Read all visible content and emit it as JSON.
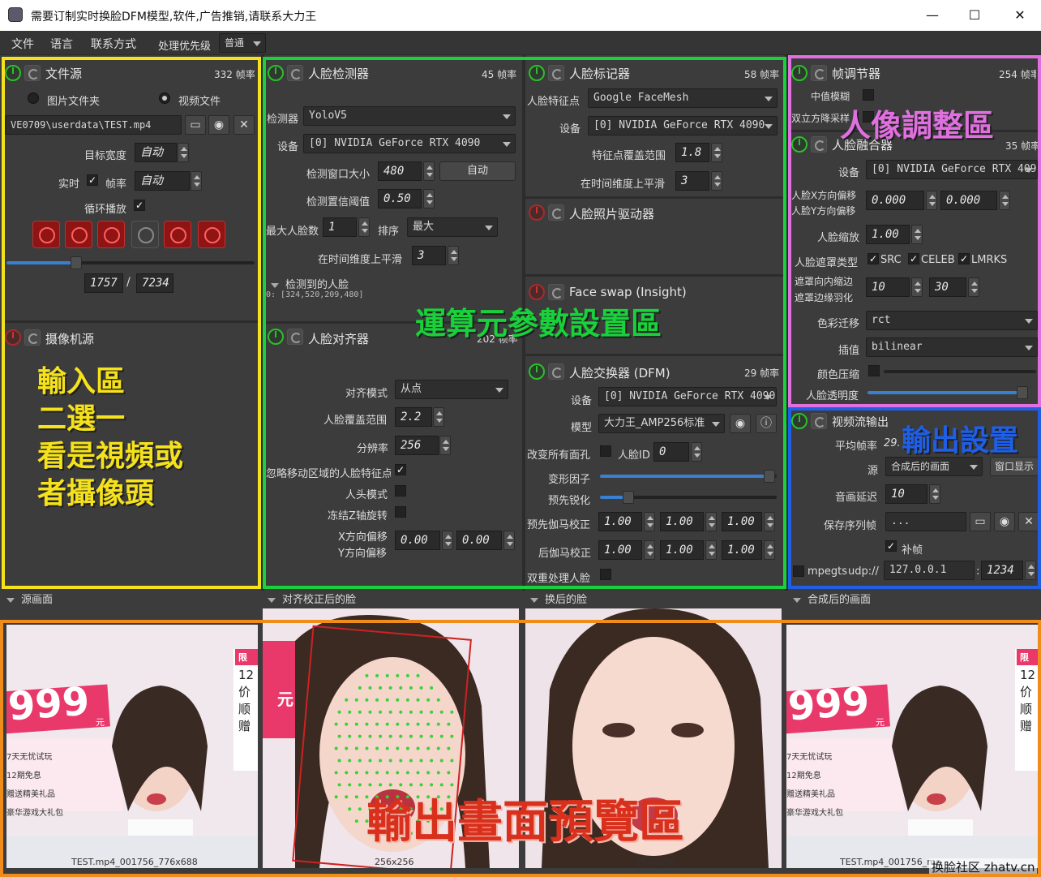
{
  "window": {
    "title": "需要订制实时换脸DFM模型,软件,广告推销,请联系大力王"
  },
  "menu": {
    "file": "文件",
    "language": "语言",
    "contact": "联系方式",
    "priority_label": "处理优先级",
    "priority_value": "普通"
  },
  "file_source": {
    "title": "文件源",
    "fps": "332 帧率",
    "image_folder": "图片文件夹",
    "video_file": "视频文件",
    "path": "VE0709\\userdata\\TEST.mp4",
    "target_width_label": "目标宽度",
    "target_width_value": "自动",
    "realtime_label": "实时",
    "fps_label": "帧率",
    "fps_value": "自动",
    "loop_label": "循环播放",
    "frame_current": "1757",
    "frame_sep": "/",
    "frame_total": "7234",
    "seek_position": 0.28
  },
  "camera_source": {
    "title": "摄像机源"
  },
  "face_detector": {
    "title": "人脸检测器",
    "fps": "45 帧率",
    "detector_label": "检测器",
    "detector_value": "YoloV5",
    "device_label": "设备",
    "device_value": "[0] NVIDIA GeForce RTX 4090",
    "window_label": "检测窗口大小",
    "window_value": "480",
    "auto_button": "自动",
    "threshold_label": "检测置信阈值",
    "threshold_value": "0.50",
    "max_faces_label": "最大人脸数",
    "max_faces_value": "1",
    "sort_label": "排序",
    "sort_value": "最大",
    "smooth_label": "在时间维度上平滑",
    "smooth_value": "3",
    "detected_label": "检测到的人脸",
    "detected_value": "0: [324,520,209,480]"
  },
  "face_aligner": {
    "title": "人脸对齐器",
    "fps": "202 帧率",
    "mode_label": "对齐模式",
    "mode_value": "从点",
    "coverage_label": "人脸覆盖范围",
    "coverage_value": "2.2",
    "resolution_label": "分辨率",
    "resolution_value": "256",
    "ignore_label": "忽略移动区域的人脸特征点",
    "head_mode_label": "人头模式",
    "freeze_z_label": "冻结Z轴旋转",
    "x_offset_label": "X方向偏移",
    "y_offset_label": "Y方向偏移",
    "x_offset_value": "0.00",
    "y_offset_value": "0.00"
  },
  "face_marker": {
    "title": "人脸标记器",
    "fps": "58 帧率",
    "landmarks_label": "人脸特征点",
    "landmarks_value": "Google FaceMesh",
    "device_label": "设备",
    "device_value": "[0] NVIDIA GeForce RTX 4090",
    "range_label": "特征点覆盖范围",
    "range_value": "1.8",
    "smooth_label": "在时间维度上平滑",
    "smooth_value": "3"
  },
  "face_animator": {
    "title": "人脸照片驱动器"
  },
  "face_swap_insight": {
    "title": "Face swap (Insight)"
  },
  "face_swapper": {
    "title": "人脸交换器 (DFM)",
    "fps": "29 帧率",
    "device_label": "设备",
    "device_value": "[0] NVIDIA GeForce RTX 4090",
    "model_label": "模型",
    "model_value": "大力王_AMP256标准",
    "swap_all_label": "改变所有面孔",
    "face_id_label": "人脸ID",
    "face_id_value": "0",
    "morph_label": "变形因子",
    "morph_position": 0.96,
    "presharpen_label": "预先锐化",
    "presharpen_position": 0.16,
    "pre_gamma_label": "预先伽马校正",
    "post_gamma_label": "后伽马校正",
    "gamma_values": [
      "1.00",
      "1.00",
      "1.00"
    ],
    "two_pass_label": "双重处理人脸"
  },
  "frame_adjuster": {
    "title": "帧调节器",
    "fps": "254 帧率",
    "median_label": "中值模糊",
    "bilinear_label": "双立方降采样"
  },
  "face_merger": {
    "title": "人脸融合器",
    "fps": "35 帧率",
    "device_label": "设备",
    "device_value": "[0] NVIDIA GeForce RTX 4090",
    "x_offset_label": "人脸X方向偏移",
    "y_offset_label": "人脸Y方向偏移",
    "x_offset_value": "0.000",
    "y_offset_value": "0.000",
    "scale_label": "人脸缩放",
    "scale_value": "1.00",
    "mask_type_label": "人脸遮罩类型",
    "mask_src": "SRC",
    "mask_celeb": "CELEB",
    "mask_lmrks": "LMRKS",
    "erode_label": "遮罩向内缩边",
    "blur_label": "遮罩边缘羽化",
    "erode_value": "10",
    "blur_value": "30",
    "color_transfer_label": "色彩迁移",
    "color_transfer_value": "rct",
    "interp_label": "插值",
    "interp_value": "bilinear",
    "color_compress_label": "颜色压缩",
    "opacity_label": "人脸透明度",
    "opacity_position": 1.0
  },
  "stream_output": {
    "title": "视频流输出",
    "avg_fps_label": "平均帧率",
    "avg_fps_value": "29.",
    "source_label": "源",
    "source_value": "合成后的画面",
    "window_button": "窗口显示",
    "delay_label": "音画延迟",
    "delay_value": "10",
    "save_label": "保存序列帧",
    "save_value": "...",
    "fill_label": "补帧",
    "mpegts_label": "mpegts",
    "udp_label": "udp://",
    "ip_value": "127.0.0.1",
    "port_sep": ":",
    "port_value": "1234"
  },
  "previews": {
    "source_title": "源画面",
    "aligned_title": "对齐校正后的脸",
    "swapped_title": "换后的脸",
    "merged_title": "合成后的画面",
    "source_caption": "TEST.mp4_001756_776x688",
    "aligned_caption": "256x256",
    "swapped_caption": "256x256",
    "merged_caption": "TEST.mp4_001756_me",
    "frame_texts": {
      "price": "999",
      "yuan": "元",
      "y": "元",
      "chip": "限",
      "t1": "12",
      "t2": "价",
      "t3": "顺",
      "t4": "赠"
    },
    "bullet_lines": [
      "7天无忧试玩",
      "12期免息",
      "赠送精美礼品",
      "豪华游戏大礼包"
    ]
  },
  "annotations": {
    "input_zone_lines": [
      "輸入區",
      "二選一",
      "看是視頻或",
      "者攝像頭"
    ],
    "param_zone": "運算元參數設置區",
    "portrait_zone": "人像調整區",
    "output_zone": "輸出設置",
    "preview_zone": "輸出畫面預覽區"
  },
  "watermark": "换脸社区 zhatv.cn",
  "colors": {
    "yellow": "#f5e21c",
    "green": "#19d13a",
    "magenta": "#e070e0",
    "blue": "#1f5fe6",
    "orange": "#f08c1a",
    "red": "#c81e1e"
  }
}
